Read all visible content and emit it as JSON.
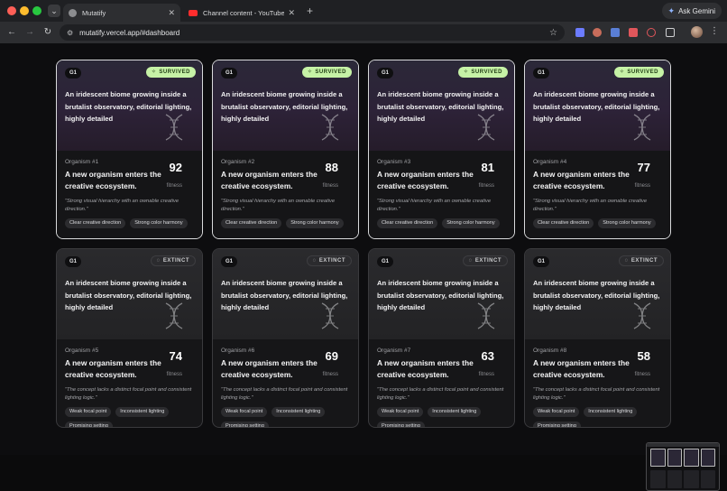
{
  "browser": {
    "tabs": [
      {
        "title": "Mutatify",
        "active": true,
        "favicon": "globe-icon"
      },
      {
        "title": "Channel content - YouTube Studio",
        "active": false,
        "favicon": "youtube-icon"
      }
    ],
    "gemini_label": "Ask Gemini",
    "url": "mutatify.vercel.app/#dashboard"
  },
  "colors": {
    "survived_badge": "#c6f2a6",
    "extinct_badge": "#2b2b2e",
    "card_border_survived": "#d9dadc"
  },
  "cards": [
    {
      "generation": "G1",
      "status": "SURVIVED",
      "prompt": "An iridescent biome growing inside a brutalist observatory, editorial lighting, highly detailed",
      "organism": "Organism #1",
      "headline": "A new organism enters the creative ecosystem.",
      "score": "92",
      "score_label": "fitness",
      "critique": "\"Strong visual hierarchy with an ownable creative direction.\"",
      "tags": [
        "Clear creative direction",
        "Strong color harmony"
      ]
    },
    {
      "generation": "G1",
      "status": "SURVIVED",
      "prompt": "An iridescent biome growing inside a brutalist observatory, editorial lighting, highly detailed",
      "organism": "Organism #2",
      "headline": "A new organism enters the creative ecosystem.",
      "score": "88",
      "score_label": "fitness",
      "critique": "\"Strong visual hierarchy with an ownable creative direction.\"",
      "tags": [
        "Clear creative direction",
        "Strong color harmony"
      ]
    },
    {
      "generation": "G1",
      "status": "SURVIVED",
      "prompt": "An iridescent biome growing inside a brutalist observatory, editorial lighting, highly detailed",
      "organism": "Organism #3",
      "headline": "A new organism enters the creative ecosystem.",
      "score": "81",
      "score_label": "fitness",
      "critique": "\"Strong visual hierarchy with an ownable creative direction.\"",
      "tags": [
        "Clear creative direction",
        "Strong color harmony"
      ]
    },
    {
      "generation": "G1",
      "status": "SURVIVED",
      "prompt": "An iridescent biome growing inside a brutalist observatory, editorial lighting, highly detailed",
      "organism": "Organism #4",
      "headline": "A new organism enters the creative ecosystem.",
      "score": "77",
      "score_label": "fitness",
      "critique": "\"Strong visual hierarchy with an ownable creative direction.\"",
      "tags": [
        "Clear creative direction",
        "Strong color harmony"
      ]
    },
    {
      "generation": "G1",
      "status": "EXTINCT",
      "prompt": "An iridescent biome growing inside a brutalist observatory, editorial lighting, highly detailed",
      "organism": "Organism #5",
      "headline": "A new organism enters the creative ecosystem.",
      "score": "74",
      "score_label": "fitness",
      "critique": "\"The concept lacks a distinct focal point and consistent lighting logic.\"",
      "tags": [
        "Weak focal point",
        "Inconsistent lighting",
        "Promising setting"
      ]
    },
    {
      "generation": "G1",
      "status": "EXTINCT",
      "prompt": "An iridescent biome growing inside a brutalist observatory, editorial lighting, highly detailed",
      "organism": "Organism #6",
      "headline": "A new organism enters the creative ecosystem.",
      "score": "69",
      "score_label": "fitness",
      "critique": "\"The concept lacks a distinct focal point and consistent lighting logic.\"",
      "tags": [
        "Weak focal point",
        "Inconsistent lighting",
        "Promising setting"
      ]
    },
    {
      "generation": "G1",
      "status": "EXTINCT",
      "prompt": "An iridescent biome growing inside a brutalist observatory, editorial lighting, highly detailed",
      "organism": "Organism #7",
      "headline": "A new organism enters the creative ecosystem.",
      "score": "63",
      "score_label": "fitness",
      "critique": "\"The concept lacks a distinct focal point and consistent lighting logic.\"",
      "tags": [
        "Weak focal point",
        "Inconsistent lighting",
        "Promising setting"
      ]
    },
    {
      "generation": "G1",
      "status": "EXTINCT",
      "prompt": "An iridescent biome growing inside a brutalist observatory, editorial lighting, highly detailed",
      "organism": "Organism #8",
      "headline": "A new organism enters the creative ecosystem.",
      "score": "58",
      "score_label": "fitness",
      "critique": "\"The concept lacks a distinct focal point and consistent lighting logic.\"",
      "tags": [
        "Weak focal point",
        "Inconsistent lighting",
        "Promising setting"
      ]
    }
  ]
}
